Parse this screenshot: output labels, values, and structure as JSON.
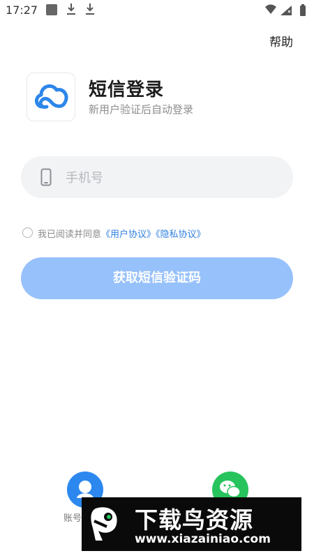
{
  "status_bar": {
    "time": "17:27"
  },
  "header": {
    "help_label": "帮助"
  },
  "brand": {
    "title": "短信登录",
    "subtitle": "新用户验证后自动登录"
  },
  "phone_field": {
    "placeholder": "手机号",
    "value": ""
  },
  "agreement": {
    "prefix": "我已阅读并同意",
    "user_agreement": "《用户协议》",
    "privacy_policy": "《隐私协议》",
    "checked": false
  },
  "actions": {
    "get_code_label": "获取短信验证码"
  },
  "login_options": {
    "account_label": "账号"
  },
  "watermark": {
    "title": "下载鸟资源",
    "url": "www.xiazainiao.com"
  },
  "colors": {
    "primary": "#2f7fe0",
    "button_disabled": "#97c1fb",
    "wechat": "#27c35d",
    "account": "#2c88ef",
    "field_bg": "#f2f3f5"
  },
  "icons": [
    "cloud-logo-icon",
    "phone-icon",
    "user-icon",
    "wechat-icon",
    "download-icon",
    "wifi-icon",
    "signal-icon",
    "battery-icon"
  ]
}
